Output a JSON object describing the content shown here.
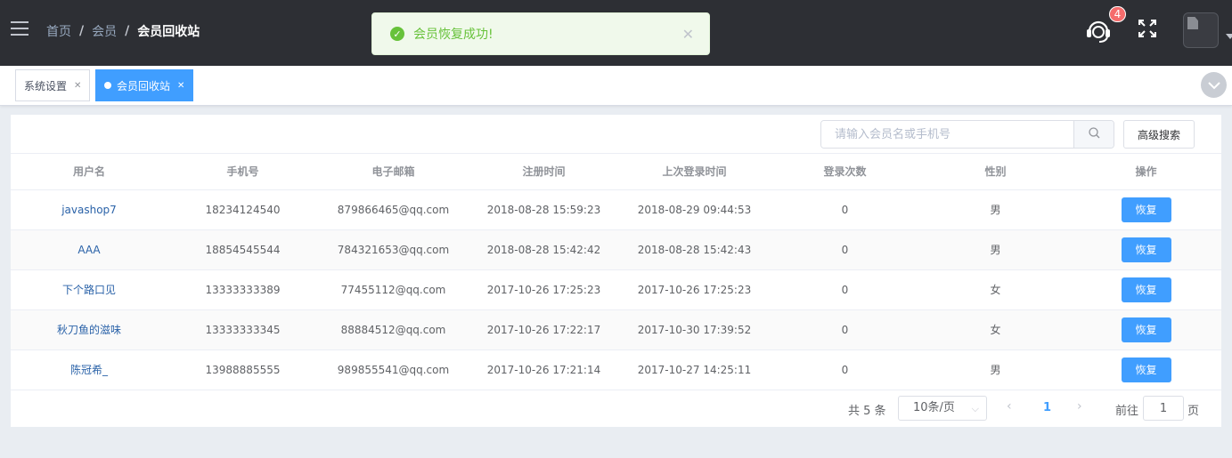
{
  "header": {
    "breadcrumb": [
      "首页",
      "会员",
      "会员回收站"
    ],
    "notification_badge": "4"
  },
  "toast": {
    "message": "会员恢复成功!",
    "type": "success"
  },
  "tags": [
    {
      "label": "系统设置",
      "active": false
    },
    {
      "label": "会员回收站",
      "active": true
    }
  ],
  "toolbar": {
    "search_placeholder": "请输入会员名或手机号",
    "advanced_search": "高级搜索"
  },
  "table": {
    "columns": [
      "用户名",
      "手机号",
      "电子邮箱",
      "注册时间",
      "上次登录时间",
      "登录次数",
      "性别",
      "操作"
    ],
    "rows": [
      {
        "username": "javashop7",
        "phone": "18234124540",
        "email": "879866465@qq.com",
        "register_time": "2018-08-28 15:59:23",
        "last_login": "2018-08-29 09:44:53",
        "login_count": "0",
        "gender": "男",
        "action": "恢复"
      },
      {
        "username": "AAA",
        "phone": "18854545544",
        "email": "784321653@qq.com",
        "register_time": "2018-08-28 15:42:42",
        "last_login": "2018-08-28 15:42:43",
        "login_count": "0",
        "gender": "男",
        "action": "恢复"
      },
      {
        "username": "下个路口见",
        "phone": "13333333389",
        "email": "77455112@qq.com",
        "register_time": "2017-10-26 17:25:23",
        "last_login": "2017-10-26 17:25:23",
        "login_count": "0",
        "gender": "女",
        "action": "恢复"
      },
      {
        "username": "秋刀鱼的滋味",
        "phone": "13333333345",
        "email": "88884512@qq.com",
        "register_time": "2017-10-26 17:22:17",
        "last_login": "2017-10-30 17:39:52",
        "login_count": "0",
        "gender": "女",
        "action": "恢复"
      },
      {
        "username": "陈冠希_",
        "phone": "13988885555",
        "email": "989855541@qq.com",
        "register_time": "2017-10-26 17:21:14",
        "last_login": "2017-10-27 14:25:11",
        "login_count": "0",
        "gender": "男",
        "action": "恢复"
      }
    ]
  },
  "pagination": {
    "total": "共 5 条",
    "page_size": "10条/页",
    "current_page": "1",
    "goto_prefix": "前往",
    "goto_value": "1",
    "goto_suffix": "页"
  },
  "colors": {
    "header_bg": "#2d2f34",
    "primary": "#409eff",
    "success": "#67c23a",
    "badge": "#f56c6c",
    "link": "#2a62a8"
  },
  "icons": [
    "hamburger-icon",
    "success-check-icon",
    "close-icon",
    "customer-service-icon",
    "fullscreen-icon",
    "avatar",
    "search-icon",
    "chevron-down-icon",
    "chevron-left-icon",
    "chevron-right-icon"
  ]
}
